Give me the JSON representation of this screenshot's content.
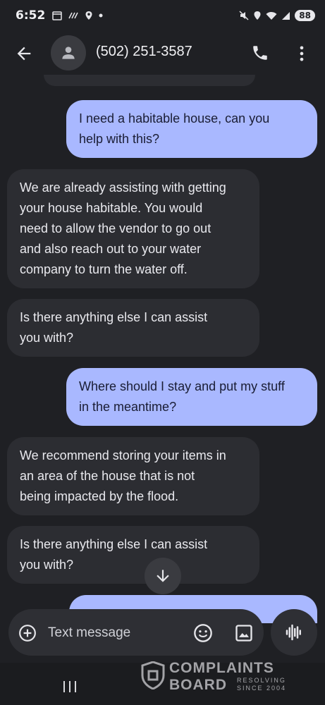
{
  "status_bar": {
    "time": "6:52",
    "battery": "88"
  },
  "header": {
    "contact": "(502) 251-3587"
  },
  "messages": [
    {
      "direction": "outgoing",
      "text": "I need a habitable house, can you\nhelp with this?"
    },
    {
      "direction": "incoming",
      "text": "We are already assisting with getting\nyour house habitable. You would\nneed to allow the vendor to go out\nand also reach out to your water\ncompany to turn the water off."
    },
    {
      "direction": "incoming",
      "text": "Is there anything else I can assist\nyou with?"
    },
    {
      "direction": "outgoing",
      "text": "Where should I stay and put my stuff\nin the meantime?"
    },
    {
      "direction": "incoming",
      "text": "We recommend storing your items in\nan area of the house that is not\nbeing impacted by the flood."
    },
    {
      "direction": "incoming",
      "text": "Is there anything else I can assist\nyou with?"
    }
  ],
  "compose": {
    "placeholder": "Text message"
  },
  "watermark": {
    "line1": "COMPLAINTS",
    "line2": "BOARD",
    "tag_line1": "RESOLVING",
    "tag_line2": "SINCE 2004"
  },
  "colors": {
    "background": "#1f2024",
    "incoming_bubble": "#2c2d32",
    "outgoing_bubble": "#a9b8ff"
  },
  "icons": [
    "back-arrow-icon",
    "person-icon",
    "phone-icon",
    "more-vert-icon",
    "arrow-down-icon",
    "add-icon",
    "emoji-icon",
    "gallery-icon",
    "voice-icon",
    "recents-icon"
  ]
}
